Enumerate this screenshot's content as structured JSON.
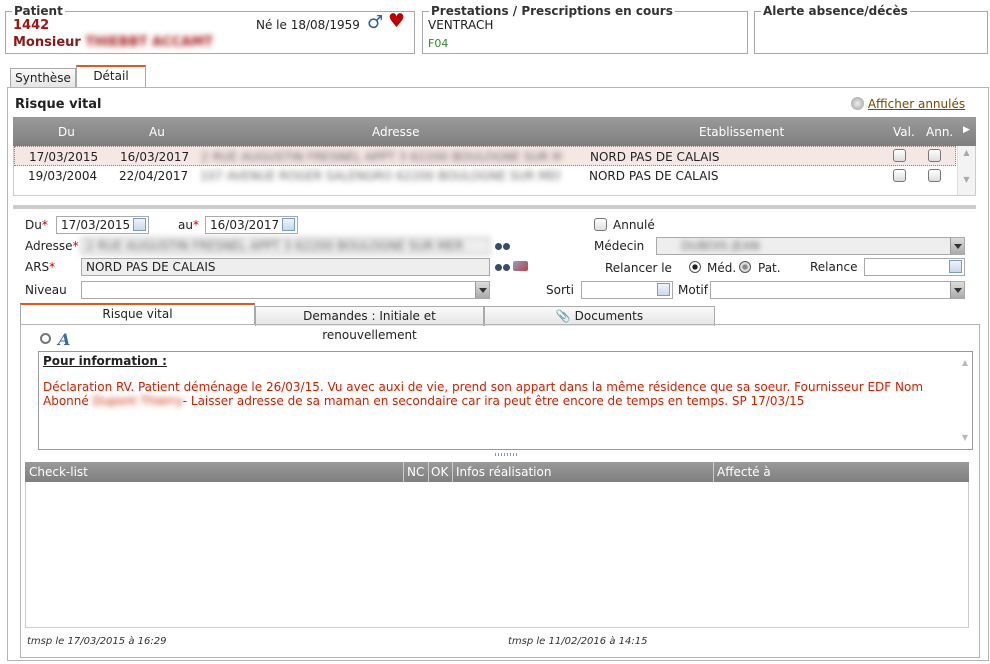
{
  "patient": {
    "legend": "Patient",
    "id": "1442",
    "name": "Monsieur",
    "name_redacted": "THIEBBT ACCAMT",
    "birth": "Né le 18/08/1959",
    "gender_icon": "male-icon",
    "risk_icon": "heart-icon"
  },
  "prestations": {
    "legend": "Prestations / Prescriptions en cours",
    "line1": "VENTRACH",
    "line2": "F04"
  },
  "alerte": {
    "legend": "Alerte absence/décès"
  },
  "tabs": {
    "synthese": "Synthèse",
    "detail": "Détail"
  },
  "section_title": "Risque vital",
  "show_cancelled": "Afficher annulés",
  "grid": {
    "headers": {
      "du": "Du",
      "au": "Au",
      "adresse": "Adresse",
      "etab": "Etablissement",
      "val": "Val.",
      "ann": "Ann."
    },
    "rows": [
      {
        "du": "17/03/2015",
        "au": "16/03/2017",
        "adresse": "2 RUE AUGUSTIN FRESNEL APPT 3 62200 BOULOGNE SUR MER",
        "etab": "NORD PAS DE CALAIS",
        "selected": true
      },
      {
        "du": "19/03/2004",
        "au": "22/04/2017",
        "adresse": "107 AVENUE ROGER SALENGRO 62200 BOULOGNE SUR MER",
        "etab": "NORD PAS DE CALAIS",
        "selected": false
      }
    ]
  },
  "form": {
    "du_label": "Du",
    "du_value": "17/03/2015",
    "au_label": "au",
    "au_value": "16/03/2017",
    "annule_label": "Annulé",
    "adresse_label": "Adresse",
    "adresse_value": "2 RUE AUGUSTIN FRESNEL APPT 3 62200 BOULOGNE SUR MER",
    "medecin_label": "Médecin",
    "medecin_value": "DUBOIS JEAN",
    "ars_label": "ARS",
    "ars_value": "NORD PAS DE CALAIS",
    "relancer_label": "Relancer le",
    "med_label": "Méd.",
    "pat_label": "Pat.",
    "relance_label": "Relance",
    "relance_value": "",
    "niveau_label": "Niveau",
    "niveau_value": "",
    "sorti_label": "Sorti",
    "sorti_value": "",
    "motif_label": "Motif",
    "motif_value": ""
  },
  "subtabs": {
    "risque": "Risque vital",
    "demandes": "Demandes : Initiale et renouvellement",
    "documents": "Documents"
  },
  "note": {
    "heading": "Pour information :",
    "line1": "Déclaration RV. Patient déménage le 26/03/15. Vu avec auxi de vie, prend son appart dans la même résidence que sa soeur. Fournisseur EDF Nom Abonné",
    "line2_redacted": "Dupont Thierry",
    "line2": "- Laisser adresse de sa maman en secondaire car ira peut être encore de temps en temps. SP 17/03/15"
  },
  "checklist": {
    "headers": {
      "check": "Check-list",
      "nc": "NC",
      "ok": "OK",
      "infos": "Infos réalisation",
      "affecte": "Affecté à"
    }
  },
  "footer": {
    "left": "tmsp le 17/03/2015 à 16:29",
    "center": "tmsp le 11/02/2016 à 14:15"
  },
  "colors": {
    "accent": "#e05a1e",
    "patient_red": "#a31515",
    "note_red": "#cc2200",
    "link": "#7a4a00"
  }
}
